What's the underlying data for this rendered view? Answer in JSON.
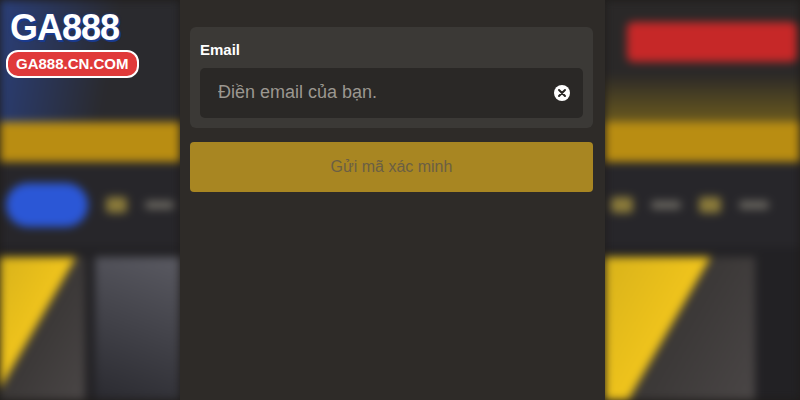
{
  "logo": {
    "name": "GA888",
    "domain": "GA888.CN.COM"
  },
  "form": {
    "label": "Email",
    "placeholder": "Điền email của bạn.",
    "button": {
      "label": "Gửi mã xác minh",
      "disabled": true
    }
  }
}
